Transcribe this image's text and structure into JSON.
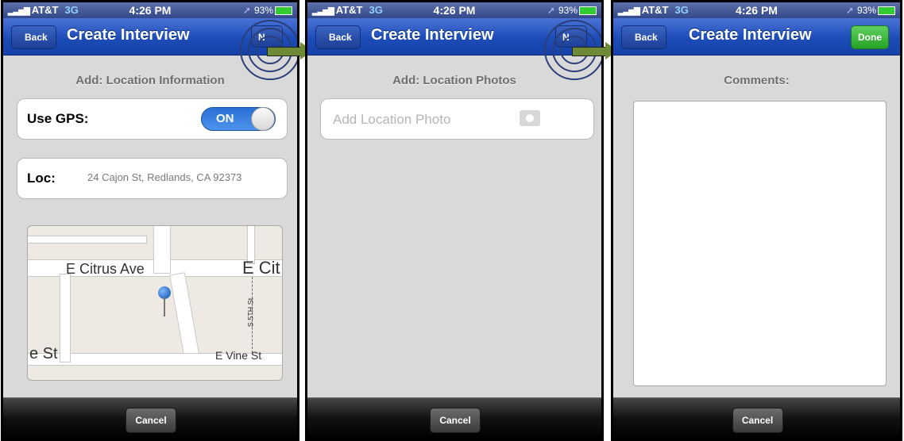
{
  "status_bar": {
    "bars": "▂▃▅▇",
    "carrier": "AT&T",
    "network": "3G",
    "time": "4:26 PM",
    "location_arrow": "➚",
    "battery": "93%"
  },
  "screens": [
    {
      "nav": {
        "back_label": "Back",
        "title": "Create Interview",
        "next_label": "N"
      },
      "section_title": "Add: Location Information",
      "gps": {
        "label": "Use GPS:",
        "toggle_text": "ON",
        "state": "on"
      },
      "location": {
        "label": "Loc:",
        "value": "24 Cajon St, Redlands, CA 92373"
      },
      "map": {
        "labels": [
          "E Citrus Ave",
          "E Cit",
          "e St",
          "E Vine St",
          "S 5TH St"
        ]
      },
      "cancel_label": "Cancel"
    },
    {
      "nav": {
        "back_label": "Back",
        "title": "Create Interview",
        "next_label": "N"
      },
      "section_title": "Add: Location Photos",
      "photo_cell": {
        "label": "Add Location Photo",
        "icon": "camera-icon"
      },
      "cancel_label": "Cancel"
    },
    {
      "nav": {
        "back_label": "Back",
        "title": "Create Interview",
        "done_label": "Done"
      },
      "section_title": "Comments:",
      "comments_value": "",
      "cancel_label": "Cancel"
    }
  ],
  "colors": {
    "nav_blue": "#1d4cb8",
    "done_green": "#26a226",
    "toggle_blue": "#2a6fd3",
    "arrow_green": "#6f8a34"
  }
}
